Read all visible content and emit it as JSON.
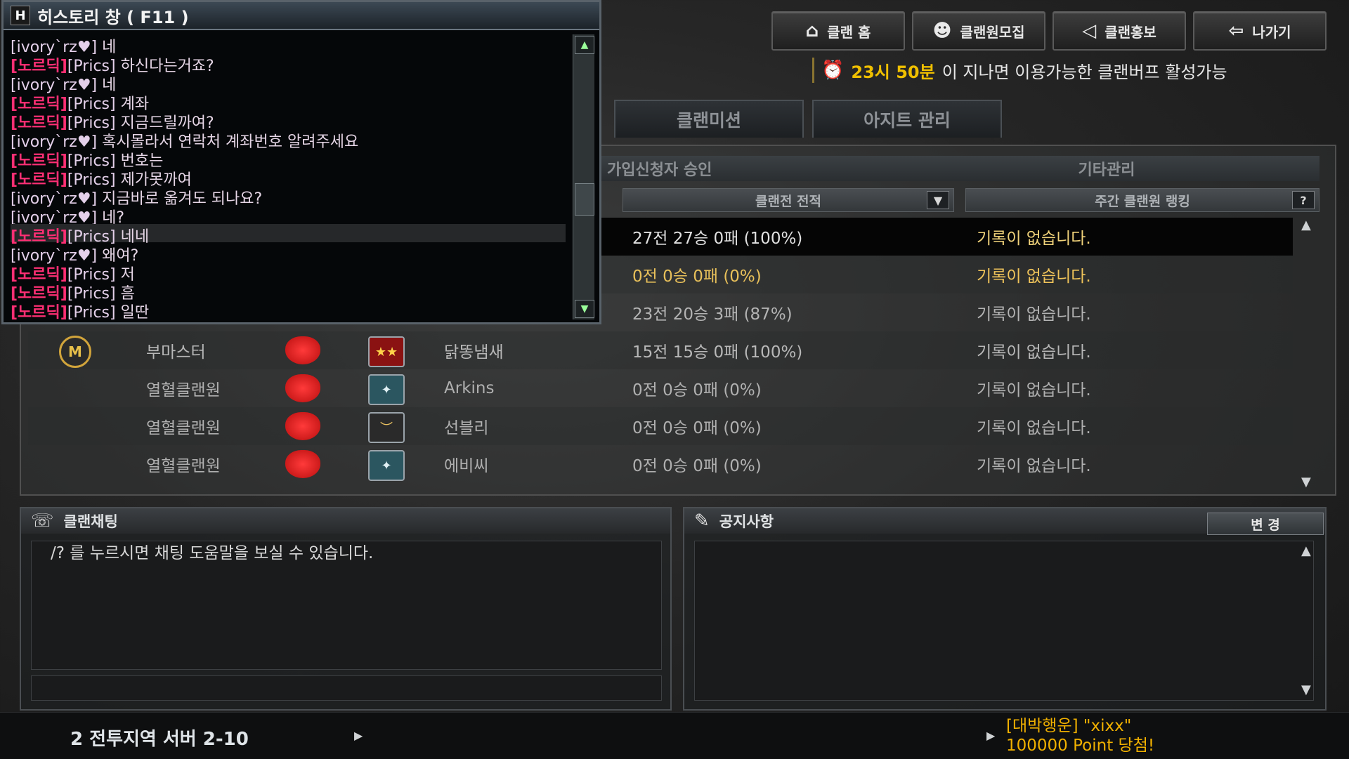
{
  "history": {
    "title_icon": "H",
    "title": "히스토리 창 ( F11 )",
    "messages": [
      {
        "name": "[ivory`rz♥]",
        "text": " 네",
        "type": "ivory"
      },
      {
        "name": "[노르딕]",
        "sub": "[Prics]",
        "text": " 하신다는거죠?",
        "type": "nordic"
      },
      {
        "name": "[ivory`rz♥]",
        "text": " 네",
        "type": "ivory"
      },
      {
        "name": "[노르딕]",
        "sub": "[Prics]",
        "text": " 계좌",
        "type": "nordic"
      },
      {
        "name": "[노르딕]",
        "sub": "[Prics]",
        "text": " 지금드릴까여?",
        "type": "nordic"
      },
      {
        "name": "[ivory`rz♥]",
        "text": " 혹시몰라서 연락처 계좌번호 알려주세요",
        "type": "ivory"
      },
      {
        "name": "[노르딕]",
        "sub": "[Prics]",
        "text": " 번호는",
        "type": "nordic"
      },
      {
        "name": "[노르딕]",
        "sub": "[Prics]",
        "text": " 제가못까여",
        "type": "nordic"
      },
      {
        "name": "[ivory`rz♥]",
        "text": " 지금바로 옮겨도 되나요?",
        "type": "ivory"
      },
      {
        "name": "[ivory`rz♥]",
        "text": " 네?",
        "type": "ivory"
      },
      {
        "name": "[노르딕]",
        "sub": "[Prics]",
        "text": " 네네",
        "type": "nordic"
      },
      {
        "name": "[ivory`rz♥]",
        "text": " 왜여?",
        "type": "ivory"
      },
      {
        "name": "[노르딕]",
        "sub": "[Prics]",
        "text": " 저",
        "type": "nordic"
      },
      {
        "name": "[노르딕]",
        "sub": "[Prics]",
        "text": " 흠",
        "type": "nordic"
      },
      {
        "name": "[노르딕]",
        "sub": "[Prics]",
        "text": " 일딴",
        "type": "nordic"
      }
    ]
  },
  "topbar": {
    "clan_home": "클랜 홈",
    "recruit": "클랜원모집",
    "promo": "클랜홍보",
    "exit": "나가기"
  },
  "notice": {
    "time": "23시 50분",
    "text": "이 지나면 이용가능한 클랜버프 활성가능"
  },
  "tabs": {
    "mission": "클랜미션",
    "agit": "아지트 관리"
  },
  "sections": {
    "approval": "가입신청자 승인",
    "etc": "기타관리"
  },
  "columns": {
    "record": "클랜전 전적",
    "ranking": "주간 클랜원 랭킹",
    "help": "?"
  },
  "members": [
    {
      "role": "",
      "name": "",
      "record": "27전 27승 0패 (100%)",
      "ranking": "기록이 없습니다."
    },
    {
      "role": "",
      "name": "",
      "record": "0전 0승 0패 (0%)",
      "ranking": "기록이 없습니다."
    },
    {
      "role": "",
      "name": "",
      "record": "23전 20승 3패 (87%)",
      "ranking": "기록이 없습니다."
    },
    {
      "role": "부마스터",
      "name": "닭똥냄새",
      "record": "15전 15승 0패 (100%)",
      "ranking": "기록이 없습니다."
    },
    {
      "role": "열혈클랜원",
      "name": "Arkins",
      "record": "0전 0승 0패 (0%)",
      "ranking": "기록이 없습니다."
    },
    {
      "role": "열혈클랜원",
      "name": "선블리",
      "record": "0전 0승 0패 (0%)",
      "ranking": "기록이 없습니다."
    },
    {
      "role": "열혈클랜원",
      "name": "에비씨",
      "record": "0전 0승 0패 (0%)",
      "ranking": "기록이 없습니다."
    }
  ],
  "chat": {
    "title": "클랜채팅",
    "help": "/? 를 누르시면 채팅 도움말을 보실 수 있습니다."
  },
  "board": {
    "title": "공지사항",
    "change": "변 경"
  },
  "status": {
    "server": "2 전투지역 서버 2-10",
    "lotto_line1": "[대박행운] \"xixx\"",
    "lotto_line2": "100000 Point 당첨!"
  },
  "colors": {
    "nordic_name": "#ff2f74",
    "notice_time": "#f0c000",
    "lotto": "#f0b000"
  }
}
